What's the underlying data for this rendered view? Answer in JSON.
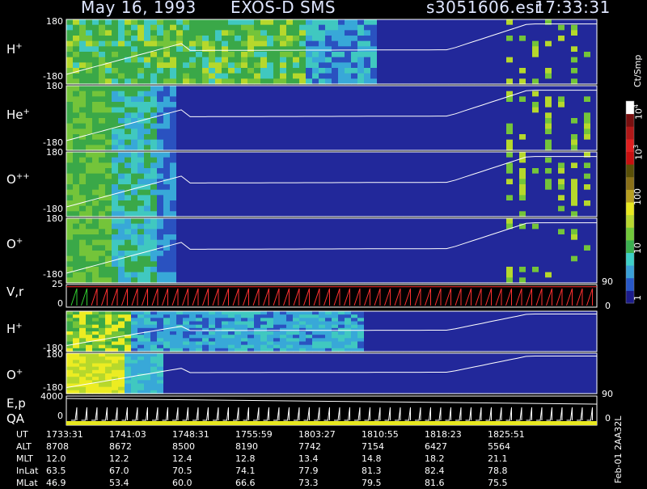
{
  "header": {
    "date": "May 16, 1993",
    "instrument": "EXOS-D SMS",
    "file": "s3051606.esr",
    "time": "17:33:31"
  },
  "panels": [
    {
      "label": "H",
      "charge": "+",
      "top_tick": "180",
      "bottom_tick": "-180"
    },
    {
      "label": "He",
      "charge": "+",
      "top_tick": "180",
      "bottom_tick": "-180"
    },
    {
      "label": "O",
      "charge": "++",
      "top_tick": "180",
      "bottom_tick": "-180"
    },
    {
      "label": "O",
      "charge": "+",
      "top_tick": "180",
      "bottom_tick": "-180"
    },
    {
      "label": "V,r",
      "charge": "",
      "top_tick": "25",
      "bottom_tick": "0"
    },
    {
      "label": "H",
      "charge": "+",
      "top_tick": "180",
      "bottom_tick": "-180"
    },
    {
      "label": "O",
      "charge": "+",
      "top_tick": "180",
      "bottom_tick": "-180"
    },
    {
      "label": "E,p",
      "charge": "",
      "top_tick": "4000",
      "bottom_tick": "0"
    }
  ],
  "qa_label": "QA",
  "right_ticks": {
    "vr_top": "90",
    "vr_bottom": "0",
    "ep_top": "90",
    "ep_bottom": "0"
  },
  "colorbar": {
    "unit": "Ct/Smp",
    "labels": [
      "1",
      "10",
      "100",
      "10^3",
      "10^4"
    ],
    "colors": [
      "#1c1c8c",
      "#2858c8",
      "#3aa0d8",
      "#3ed0c8",
      "#3ab050",
      "#72c83a",
      "#b8d830",
      "#e8e820",
      "#b8a020",
      "#8a7018",
      "#5a5008",
      "#c81010",
      "#e02020",
      "#b01818",
      "#7a1010",
      "#ffffff"
    ]
  },
  "side_text": "Feb-01 2AA32L",
  "chart_data": {
    "type": "heatmap",
    "title": "May 16, 1993   EXOS-D SMS",
    "xlabel": "UT",
    "x": [
      "1733:31",
      "1741:03",
      "1748:31",
      "1755:59",
      "1803:27",
      "1810:55",
      "1818:23",
      "1825:51"
    ],
    "ylim": [
      -180,
      180
    ],
    "color_scale": "log",
    "color_range": [
      1,
      10000
    ]
  },
  "table": {
    "rows": [
      {
        "label": "UT",
        "values": [
          "1733:31",
          "1741:03",
          "1748:31",
          "1755:59",
          "1803:27",
          "1810:55",
          "1818:23",
          "1825:51"
        ]
      },
      {
        "label": "ALT",
        "values": [
          "8708",
          "8672",
          "8500",
          "8190",
          "7742",
          "7154",
          "6427",
          "5564"
        ]
      },
      {
        "label": "MLT",
        "values": [
          "12.0",
          "12.2",
          "12.4",
          "12.8",
          "13.4",
          "14.8",
          "18.2",
          "21.1"
        ]
      },
      {
        "label": "InLat",
        "values": [
          "63.5",
          "67.0",
          "70.5",
          "74.1",
          "77.9",
          "81.3",
          "82.4",
          "78.8"
        ]
      },
      {
        "label": "MLat",
        "values": [
          "46.9",
          "53.4",
          "60.0",
          "66.6",
          "73.3",
          "79.5",
          "81.6",
          "75.5"
        ]
      }
    ]
  }
}
